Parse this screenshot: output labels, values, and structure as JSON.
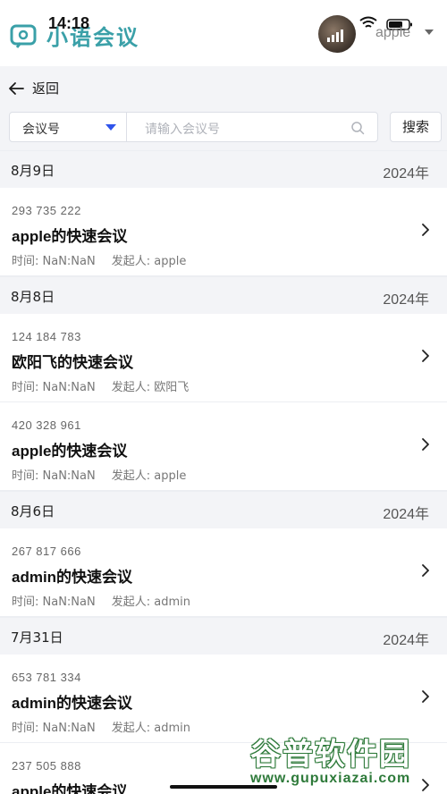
{
  "status_bar": {
    "time": "14:18"
  },
  "app": {
    "logo_text": "小语会议"
  },
  "user": {
    "name": "apple"
  },
  "nav": {
    "back_label": "返回"
  },
  "search": {
    "type_selected": "会议号",
    "placeholder": "请输入会议号",
    "button_label": "搜索"
  },
  "colors": {
    "accent": "#2f54eb",
    "logo": "#3aa0a8",
    "panel_bg": "#f3f4f7"
  },
  "groups": [
    {
      "date": "8月9日",
      "year": "2024年",
      "meetings": [
        {
          "id": "293 735 222",
          "title": "apple的快速会议",
          "time": "时间: NaN:NaN",
          "host": "发起人: apple"
        }
      ]
    },
    {
      "date": "8月8日",
      "year": "2024年",
      "meetings": [
        {
          "id": "124 184 783",
          "title": "欧阳飞的快速会议",
          "time": "时间: NaN:NaN",
          "host": "发起人: 欧阳飞"
        },
        {
          "id": "420 328 961",
          "title": "apple的快速会议",
          "time": "时间: NaN:NaN",
          "host": "发起人: apple"
        }
      ]
    },
    {
      "date": "8月6日",
      "year": "2024年",
      "meetings": [
        {
          "id": "267 817 666",
          "title": "admin的快速会议",
          "time": "时间: NaN:NaN",
          "host": "发起人: admin"
        }
      ]
    },
    {
      "date": "7月31日",
      "year": "2024年",
      "meetings": [
        {
          "id": "653 781 334",
          "title": "admin的快速会议",
          "time": "时间: NaN:NaN",
          "host": "发起人: admin"
        },
        {
          "id": "237 505 888",
          "title": "apple的快速会议",
          "time": "",
          "host": ""
        }
      ]
    }
  ],
  "watermark": {
    "title": "谷普软件园",
    "url": "www.gupuxiazai.com"
  }
}
